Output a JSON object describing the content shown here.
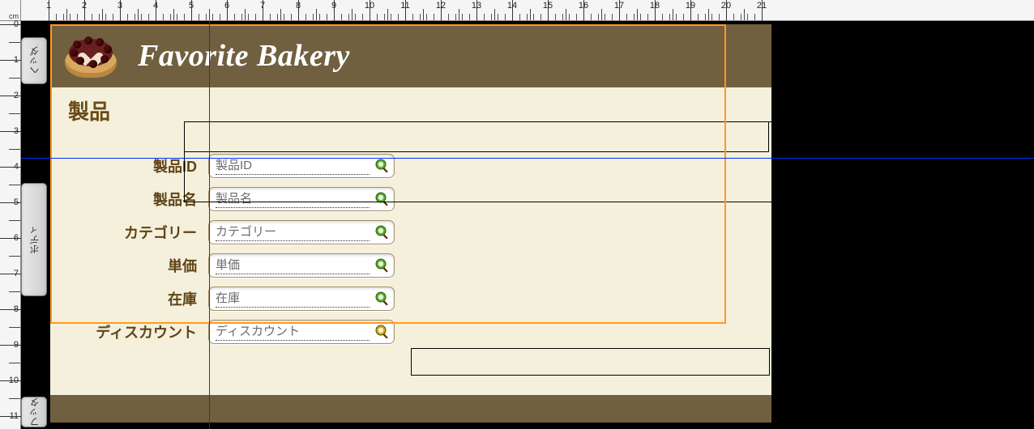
{
  "ruler": {
    "unit": "cm",
    "h_max": 21,
    "v_max": 11
  },
  "parts": {
    "header_label": "ヘッダ",
    "body_label": "ボディ",
    "footer_label": "フッタ"
  },
  "header": {
    "title": "Favorite Bakery"
  },
  "section": {
    "title": "製品"
  },
  "form": {
    "rows": [
      {
        "label": "製品ID",
        "placeholder": "製品ID",
        "lookup_color": "green"
      },
      {
        "label": "製品名",
        "placeholder": "製品名",
        "lookup_color": "green"
      },
      {
        "label": "カテゴリー",
        "placeholder": "カテゴリー",
        "lookup_color": "green"
      },
      {
        "label": "単価",
        "placeholder": "単価",
        "lookup_color": "green"
      },
      {
        "label": "在庫",
        "placeholder": "在庫",
        "lookup_color": "green"
      },
      {
        "label": "ディスカウント",
        "placeholder": "ディスカウント",
        "lookup_color": "orange"
      }
    ]
  },
  "colors": {
    "header_bg": "#706040",
    "body_bg": "#f5f0dc",
    "accent_text": "#5e4416",
    "selection": "#ff9a1a",
    "guide": "#0030ff"
  }
}
